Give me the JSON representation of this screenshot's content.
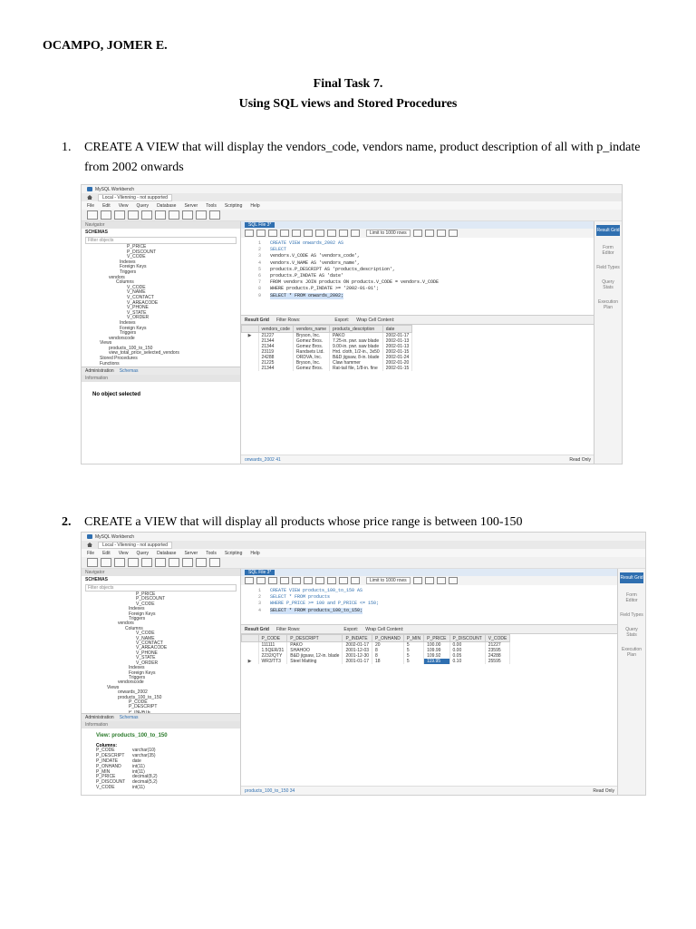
{
  "author": "OCAMPO, JOMER E.",
  "title1": "Final Task 7.",
  "title2": "Using SQL views and Stored Procedures",
  "questions": [
    {
      "num": "1.",
      "text": "CREATE A VIEW that will display the vendors_code, vendors name, product description of all with p_indate from 2002 onwards"
    },
    {
      "num": "2.",
      "text": "CREATE a VIEW that will display all products whose price range is between 100-150"
    }
  ],
  "workbench": {
    "app_title": "MySQL Workbench",
    "connection_tab": "Local - Vilenning - not supported",
    "menu": [
      "File",
      "Edit",
      "View",
      "Query",
      "Database",
      "Server",
      "Tools",
      "Scripting",
      "Help"
    ],
    "navigator": "Navigator",
    "schemas": "SCHEMAS",
    "filter_placeholder": "Filter objects",
    "sql_tab": "SQL File 3*",
    "limit": "Limit to 1000 rows",
    "result_grid": "Result Grid",
    "filter_rows": "Filter Rows:",
    "export": "Export:",
    "wrap": "Wrap Cell Content:",
    "read_only": "Read Only",
    "admin_tab": "Administration",
    "schemas_tab": "Schemas",
    "information": "Information",
    "side_panel": [
      "Result Grid",
      "Form Editor",
      "Field Types",
      "Query Stats",
      "Execution Plan"
    ]
  },
  "shot1": {
    "tree": [
      "P_PRICE",
      "P_DISCOUNT",
      "V_CODE",
      "Indexes",
      "Foreign Keys",
      "Triggers",
      "vendors",
      "Columns",
      "V_CODE",
      "V_NAME",
      "V_CONTACT",
      "V_AREACODE",
      "V_PHONE",
      "V_STATE",
      "V_ORDER",
      "Indexes",
      "Foreign Keys",
      "Triggers",
      "vendorscode",
      "Views",
      "products_100_to_150",
      "view_total_price_selected_vendors",
      "Stored Procedures",
      "Functions"
    ],
    "info": "No object selected",
    "code": [
      [
        "1",
        "CREATE VIEW onwards_2002 AS"
      ],
      [
        "2",
        "SELECT"
      ],
      [
        "3",
        "vendors.V_CODE AS 'vendors_code',"
      ],
      [
        "4",
        "vendors.V_NAME AS 'vendors_name',"
      ],
      [
        "5",
        "products.P_DESCRIPT AS 'products_description',"
      ],
      [
        "6",
        "products.P_INDATE AS 'date'"
      ],
      [
        "7",
        "FROM vendors JOIN products ON products.V_CODE = vendors.V_CODE"
      ],
      [
        "8",
        "WHERE products.P_INDATE >= '2002-01-01';"
      ],
      [
        "9",
        "SELECT * FROM onwards_2002;"
      ]
    ],
    "columns": [
      "vendors_code",
      "vendors_name",
      "products_description",
      "date"
    ],
    "rows": [
      [
        "21227",
        "Bryson, Inc.",
        "PAKO",
        "2002-01-17"
      ],
      [
        "21344",
        "Gomez Bros.",
        "7.25-in. pwr. saw blade",
        "2002-01-13"
      ],
      [
        "21344",
        "Gomez Bros.",
        "9.00-in. pwr. saw blade",
        "2002-01-13"
      ],
      [
        "23119",
        "Randsets Ltd.",
        "Hrd. cloth, 1/2-in., 3x50",
        "2002-01-15"
      ],
      [
        "24288",
        "ORDVA, Inc.",
        "B&D jigsaw, 8-in. blade",
        "2002-01-24"
      ],
      [
        "21225",
        "Bryson, Inc.",
        "Claw hammer",
        "2002-01-20"
      ],
      [
        "21344",
        "Gomez Bros.",
        "Rat-tail file, 1/8-in. fine",
        "2002-01-15"
      ]
    ],
    "status": "onwards_2002 41"
  },
  "shot2": {
    "tree": [
      "P_PRICE",
      "P_DISCOUNT",
      "V_CODE",
      "Indexes",
      "Foreign Keys",
      "Triggers",
      "vendors",
      "Columns",
      "V_CODE",
      "V_NAME",
      "V_CONTACT",
      "V_AREACODE",
      "V_PHONE",
      "V_STATE",
      "V_ORDER",
      "Indexes",
      "Foreign Keys",
      "Triggers",
      "vendorscode",
      "Views",
      "onwards_2002",
      "products_100_to_150",
      "P_CODE",
      "P_DESCRIPT",
      "P_INDATE"
    ],
    "info_title": "View: products_100_to_150",
    "info_columns_label": "Columns:",
    "info_columns": [
      [
        "P_CODE",
        "varchar(10)"
      ],
      [
        "P_DESCRIPT",
        "varchar(35)"
      ],
      [
        "P_INDATE",
        "date"
      ],
      [
        "P_ONHAND",
        "int(11)"
      ],
      [
        "P_MIN",
        "int(11)"
      ],
      [
        "P_PRICE",
        "decimal(8,2)"
      ],
      [
        "P_DISCOUNT",
        "decimal(5,2)"
      ],
      [
        "V_CODE",
        "int(11)"
      ]
    ],
    "code": [
      [
        "1",
        "CREATE VIEW products_100_to_150 AS"
      ],
      [
        "2",
        "SELECT * FROM products"
      ],
      [
        "3",
        "WHERE P_PRICE >= 100 and P_PRICE <= 150;"
      ],
      [
        "4",
        "SELECT * FROM products_100_to_150;"
      ]
    ],
    "columns": [
      "P_CODE",
      "P_DESCRIPT",
      "P_INDATE",
      "P_ONHAND",
      "P_MIN",
      "P_PRICE",
      "P_DISCOUNT",
      "V_CODE"
    ],
    "rows": [
      [
        "111111",
        "PAKO",
        "2002-01-17",
        "20",
        "5",
        "100.00",
        "0.00",
        "21227"
      ],
      [
        "1.5QER/31",
        "SHAHOO",
        "2001-12-03",
        "8",
        "5",
        "109.99",
        "0.00",
        "23595"
      ],
      [
        "2232/QTY",
        "B&D jigsaw, 12-in. blade",
        "2001-12-30",
        "8",
        "5",
        "109.92",
        "0.05",
        "24288"
      ],
      [
        "WR3/TT3",
        "Steel Matting",
        "2001-01-17",
        "18",
        "5",
        "119.95",
        "0.10",
        "25595"
      ]
    ],
    "status": "products_100_to_150 34"
  }
}
